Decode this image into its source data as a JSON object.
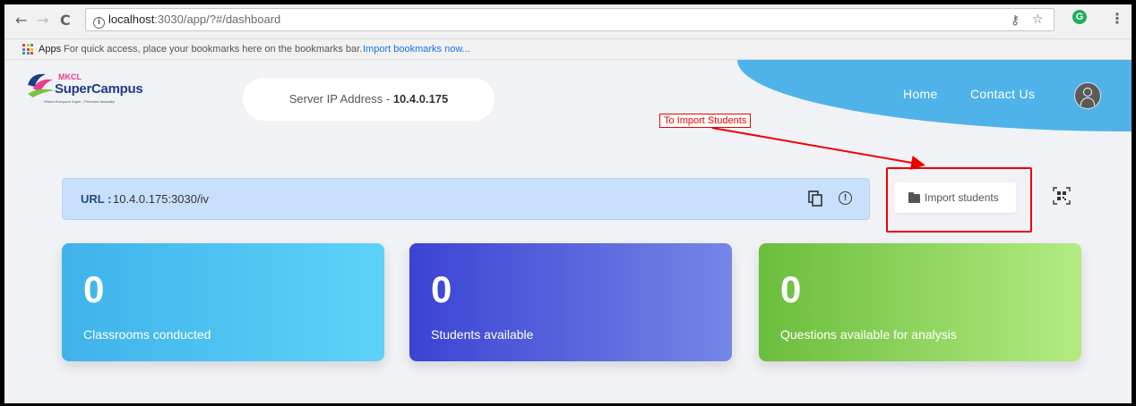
{
  "browser": {
    "url_host": "localhost",
    "url_path": ":3030/app/?#/dashboard",
    "back": "←",
    "forward": "→",
    "reload": "C",
    "key_icon": "key-icon",
    "star": "☆",
    "ext_letter": "G",
    "menu": "⋮",
    "bookmarks": {
      "apps_label": "Apps",
      "hint": "For quick access, place your bookmarks here on the bookmarks bar.",
      "import_link": "Import bookmarks now..."
    }
  },
  "app": {
    "logo": {
      "mkcl": "MKCL",
      "name": "SuperCampus",
      "tagline": "Where Everyone Super - Performs Naturally!"
    },
    "server": {
      "label": "Server IP Address - ",
      "ip": "10.4.0.175"
    },
    "nav": {
      "home": "Home",
      "contact": "Contact Us"
    },
    "url_bar": {
      "label": "URL :",
      "value": "10.4.0.175:3030/iv"
    },
    "import_button": "Import students",
    "annotation": "To Import Students",
    "cards": [
      {
        "value": "0",
        "caption": "Classrooms conducted"
      },
      {
        "value": "0",
        "caption": "Students available"
      },
      {
        "value": "0",
        "caption": "Questions available for analysis"
      }
    ],
    "colors": {
      "accent": "#4fb3ea",
      "annotation": "#e00000",
      "card1": "#3fb3ea",
      "card2": "#3b43d3",
      "card3": "#6bbd3c"
    }
  }
}
